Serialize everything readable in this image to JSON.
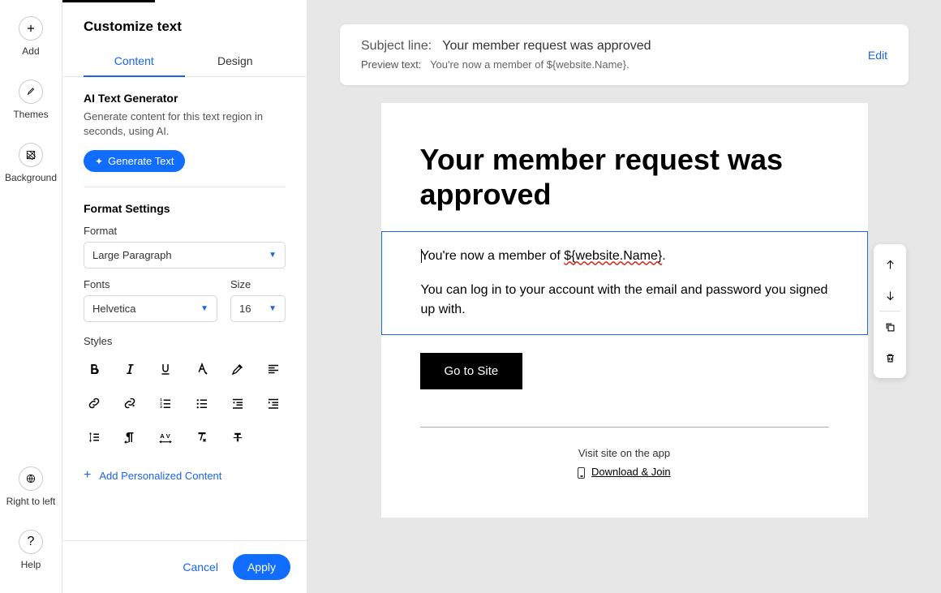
{
  "rail": {
    "add": "Add",
    "themes": "Themes",
    "background": "Background",
    "rtl": "Right to left",
    "help": "Help"
  },
  "sidebar": {
    "title": "Customize text",
    "tabs": {
      "content": "Content",
      "design": "Design"
    },
    "ai": {
      "heading": "AI Text Generator",
      "desc": "Generate content for this text region in seconds, using AI.",
      "button": "Generate Text"
    },
    "format_settings": "Format Settings",
    "format": {
      "label": "Format",
      "value": "Large Paragraph"
    },
    "fonts": {
      "label": "Fonts",
      "value": "Helvetica"
    },
    "size": {
      "label": "Size",
      "value": "16"
    },
    "styles_label": "Styles",
    "personalized": "Add Personalized Content",
    "cancel": "Cancel",
    "apply": "Apply"
  },
  "subject": {
    "subject_label": "Subject line:",
    "subject_value": "Your member request was approved",
    "preview_label": "Preview text:",
    "preview_value": "You're now a member of ${website.Name}.",
    "edit": "Edit"
  },
  "email": {
    "heading": "Your member request was approved",
    "p1_a": "You're now a member of ",
    "p1_var": "${website.Name}",
    "p1_b": ".",
    "p2": "You can log in to your account with the email and password you signed up with.",
    "cta": "Go to Site",
    "visit": "Visit site on the app",
    "download": "Download & Join"
  }
}
